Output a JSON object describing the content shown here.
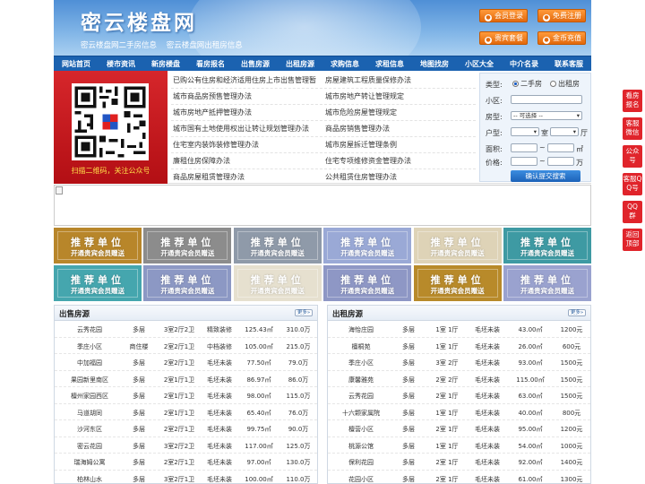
{
  "header": {
    "logo": "密云楼盘网",
    "sublinks": [
      "密云楼盘网二手房信息",
      "密云楼盘网出租房信息"
    ],
    "buttons": [
      "会员登录",
      "免费注册",
      "贵宾套餐",
      "金币充值"
    ]
  },
  "nav": [
    "网站首页",
    "楼市资讯",
    "新房楼盘",
    "看房报名",
    "出售房源",
    "出租房源",
    "求购信息",
    "求租信息",
    "地图找房",
    "小区大全",
    "中介名录",
    "联系客服"
  ],
  "qr_caption": "扫描二维码，关注公众号",
  "info_links": [
    [
      "已购公有住房和经济适用住房上市出售管理暂",
      "房屋建筑工程质量保修办法"
    ],
    [
      "城市商品房预售管理办法",
      "城市房地产转让管理规定"
    ],
    [
      "城市房地产抵押管理办法",
      "城市危险房屋管理规定"
    ],
    [
      "城市国有土地使用权出让转让规划管理办法",
      "商品房销售管理办法"
    ],
    [
      "住宅室内装饰装修管理办法",
      "城市房屋拆迁管理条例"
    ],
    [
      "廉租住房保障办法",
      "住宅专项维修资金管理办法"
    ],
    [
      "商品房屋租赁管理办法",
      "公共租赁住房管理办法"
    ]
  ],
  "search": {
    "type_label": "类型:",
    "type_options": [
      "二手房",
      "出租房"
    ],
    "community_label": "小区:",
    "house_label": "房型:",
    "house_select": "-- 可选择 --",
    "layout_label": "户型:",
    "room_unit": "室",
    "hall_unit": "厅",
    "area_label": "面积:",
    "area_unit": "㎡",
    "price_label": "价格:",
    "price_unit": "万",
    "submit": "确认提交搜索"
  },
  "recommend": {
    "title": "推荐单位",
    "subtitle": "开通贵宾会员赠送",
    "colors": [
      "#b8862a",
      "#8c8c8c",
      "#8f9aa9",
      "#9aa9d6",
      "#ded3b7",
      "#3e9aa3",
      "#45a6ae",
      "#8c98c4",
      "#e6e0cf",
      "#8e97c5",
      "#b88a2a",
      "#9aa2cf"
    ]
  },
  "sale": {
    "title": "出售房源",
    "more": "更多»",
    "rows": [
      [
        "云秀花园",
        "多层",
        "3室2厅2卫",
        "精致装修",
        "125.43㎡",
        "310.0万"
      ],
      [
        "季庄小区",
        "商住楼",
        "2室2厅1卫",
        "中档装修",
        "105.00㎡",
        "215.0万"
      ],
      [
        "中加福园",
        "多层",
        "2室2厅1卫",
        "毛坯未装",
        "77.50㎡",
        "79.0万"
      ],
      [
        "果园新里南区",
        "多层",
        "2室1厅1卫",
        "毛坯未装",
        "86.97㎡",
        "86.0万"
      ],
      [
        "檀州家园西区",
        "多层",
        "2室1厅1卫",
        "毛坯未装",
        "98.00㎡",
        "115.0万"
      ],
      [
        "马道胡同",
        "多层",
        "2室1厅1卫",
        "毛坯未装",
        "65.40㎡",
        "76.0万"
      ],
      [
        "沙河东区",
        "多层",
        "2室2厅1卫",
        "毛坯未装",
        "99.75㎡",
        "90.0万"
      ],
      [
        "密云花园",
        "多层",
        "3室2厅2卫",
        "毛坯未装",
        "117.00㎡",
        "125.0万"
      ],
      [
        "瑞海姆公寓",
        "多层",
        "2室2厅1卫",
        "毛坯未装",
        "97.00㎡",
        "130.0万"
      ],
      [
        "柏林山水",
        "多层",
        "3室2厅1卫",
        "毛坯未装",
        "100.00㎡",
        "110.0万"
      ]
    ]
  },
  "rent": {
    "title": "出租房源",
    "more": "更多»",
    "rows": [
      [
        "海怡庄园",
        "多层",
        "1室 1厅",
        "毛坯未装",
        "43.00㎡",
        "1200元"
      ],
      [
        "檀桐苑",
        "多层",
        "1室 1厅",
        "毛坯未装",
        "26.00㎡",
        "600元"
      ],
      [
        "季庄小区",
        "多层",
        "3室 2厅",
        "毛坯未装",
        "93.00㎡",
        "1500元"
      ],
      [
        "康馨雅苑",
        "多层",
        "2室 2厅",
        "毛坯未装",
        "115.00㎡",
        "1500元"
      ],
      [
        "云秀花园",
        "多层",
        "2室 1厅",
        "毛坯未装",
        "63.00㎡",
        "1500元"
      ],
      [
        "十六颗家属院",
        "多层",
        "1室 1厅",
        "毛坯未装",
        "40.00㎡",
        "800元"
      ],
      [
        "檀营小区",
        "多层",
        "2室 1厅",
        "毛坯未装",
        "95.00㎡",
        "1200元"
      ],
      [
        "桃源公馆",
        "多层",
        "1室 1厅",
        "毛坯未装",
        "54.00㎡",
        "1000元"
      ],
      [
        "保利花园",
        "多层",
        "2室 1厅",
        "毛坯未装",
        "92.00㎡",
        "1400元"
      ],
      [
        "花园小区",
        "多层",
        "2室 1厅",
        "毛坯未装",
        "61.00㎡",
        "1300元"
      ]
    ]
  },
  "side_buttons": [
    "看房报名",
    "客服微信",
    "公众号",
    "客服QQ号",
    "QQ群",
    "返回顶部"
  ]
}
